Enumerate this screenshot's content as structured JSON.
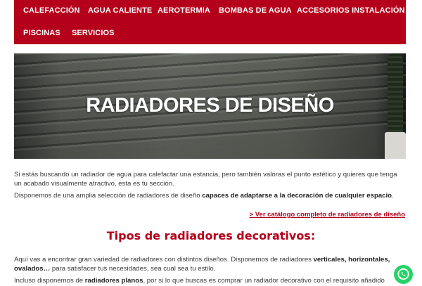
{
  "nav": {
    "items": [
      {
        "label": "CALEFACCIÓN"
      },
      {
        "label": "AGUA CALIENTE"
      },
      {
        "label": "AEROTERMIA"
      },
      {
        "label": "BOMBAS DE AGUA"
      },
      {
        "label": "ACCESORIOS INSTALACIÓN"
      },
      {
        "label": "PISCINAS"
      },
      {
        "label": "SERVICIOS"
      }
    ]
  },
  "hero": {
    "title": "RADIADORES DE DISEÑO"
  },
  "intro": {
    "p1": "Si estás buscando un radiador de agua para calefactar una estancia, pero también valoras el punto estético y quieres que tenga un acabado visualmente atractivo, esta es tu sección.",
    "p2_start": "Disponemos de una amplia selección de radiadores de diseño ",
    "p2_bold": "capaces de adaptarse a la decoración de cualquier espacio",
    "p2_end": "."
  },
  "catalog_link": "> Ver catálogo completo de radiadores de diseño",
  "section": {
    "title": "Tipos de radiadores decorativos:",
    "p3_start": "Aquí vas a encontrar gran variedad de radiadores con distintos diseños. Disponemos de radiadores ",
    "p3_bold": "verticales, horizontales, ovalados…",
    "p3_end": " para satisfacer tus necesidades, sea cual sea tu estilo.",
    "p4_start": "Incluso disponemos de ",
    "p4_bold": "radiadores planos",
    "p4_end": ", por si lo que buscas es comprar un radiador decorativo con el requisito añadido de"
  },
  "colors": {
    "brand_red": "#b5001b",
    "whatsapp_green": "#25d366"
  },
  "icons": {
    "whatsapp": "whatsapp-icon"
  }
}
